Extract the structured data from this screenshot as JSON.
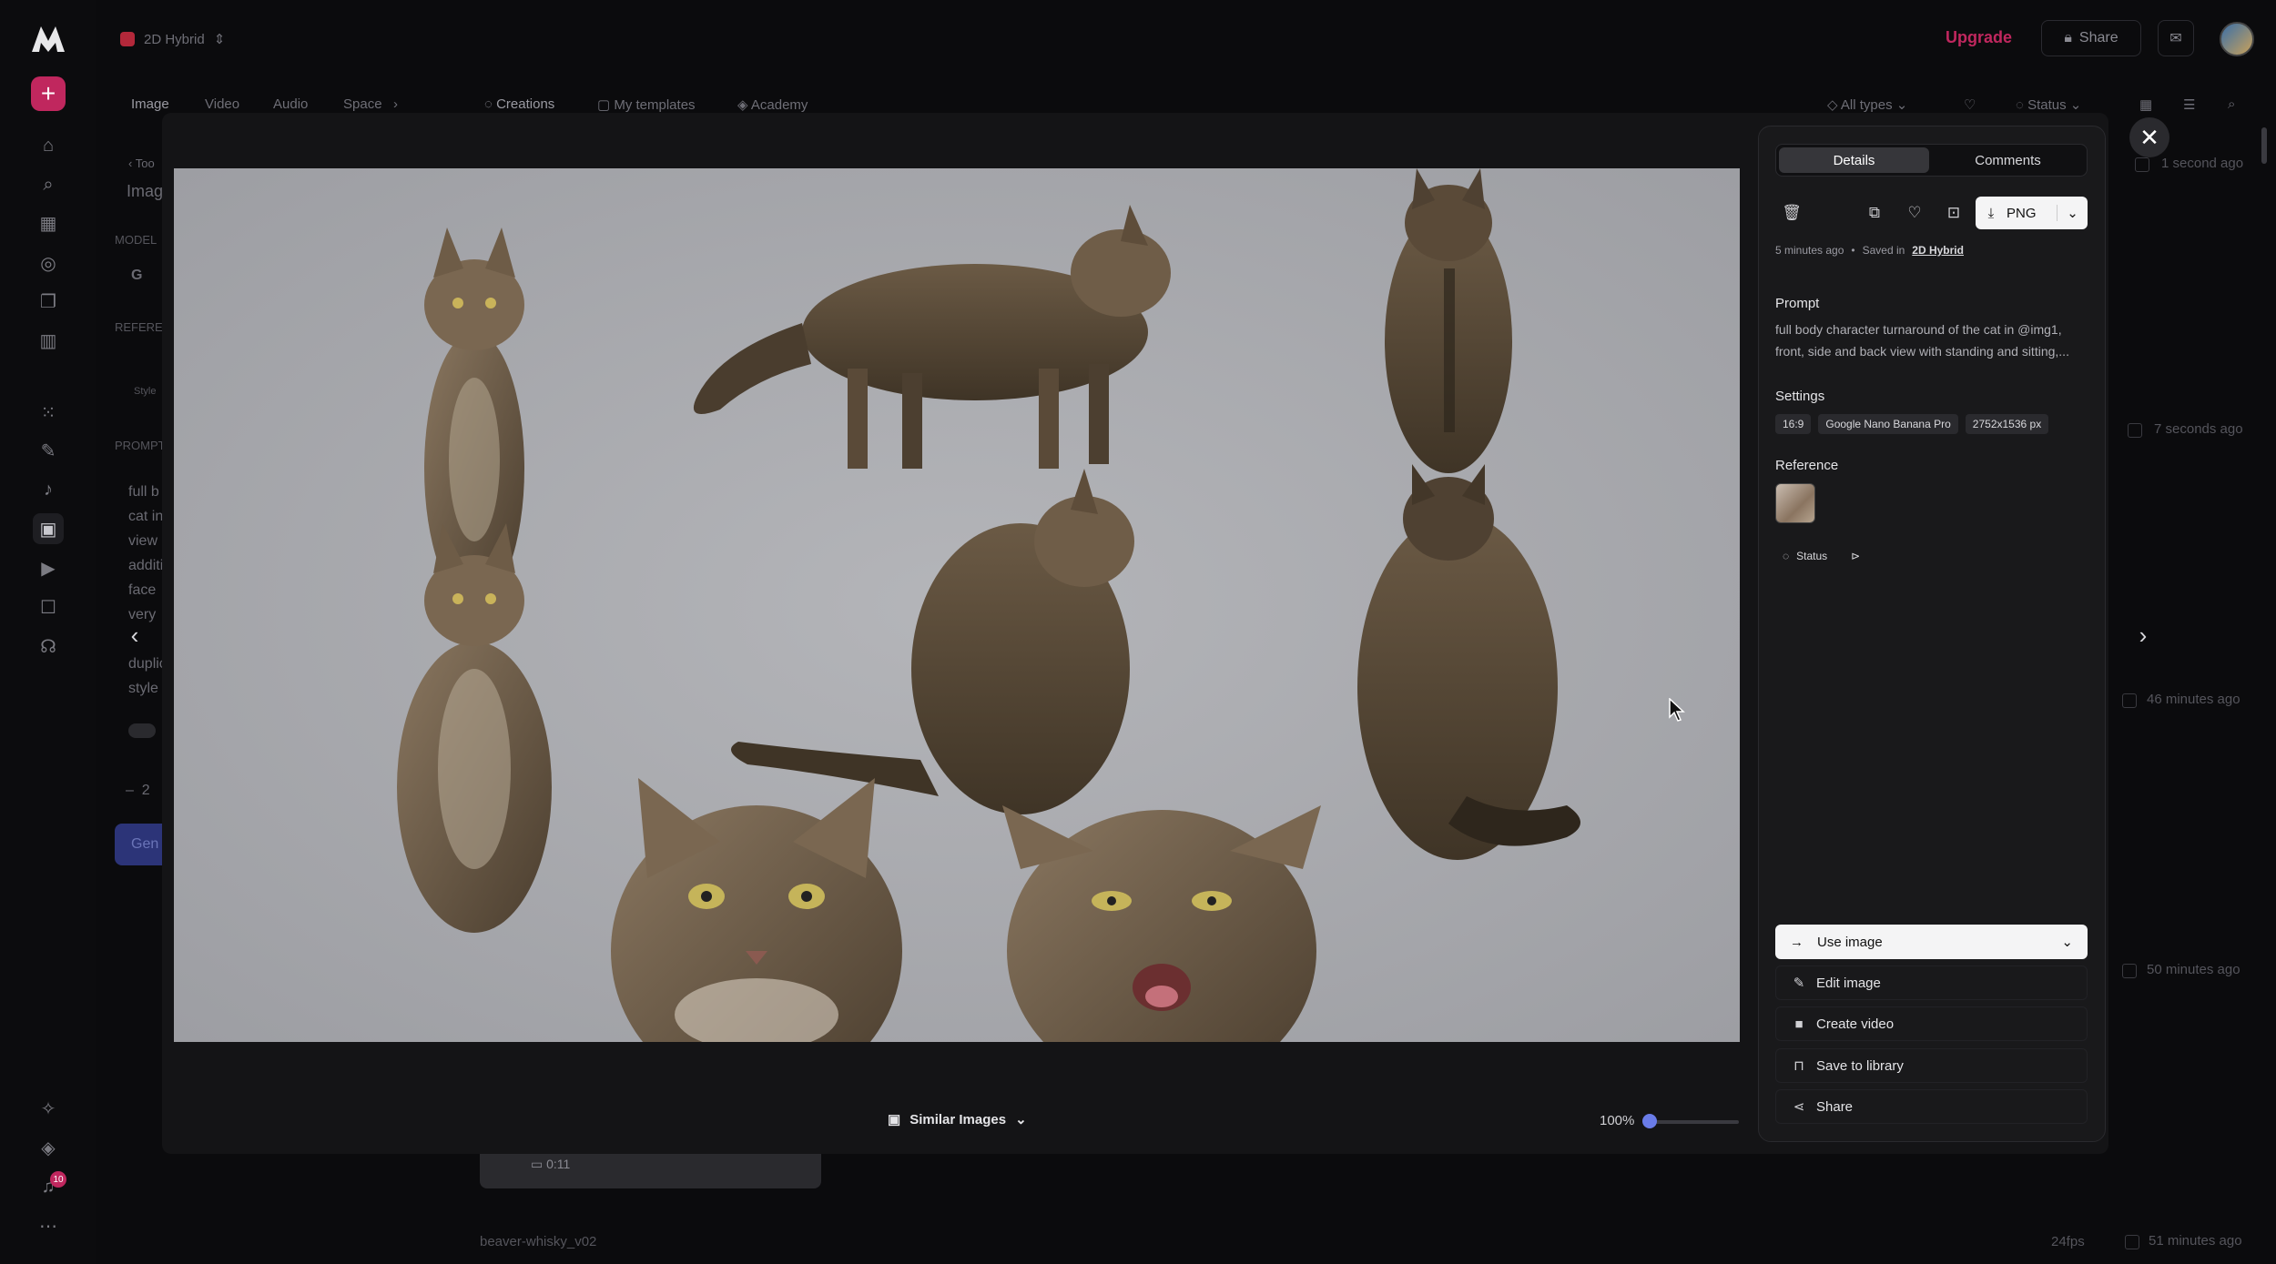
{
  "topbar": {
    "project_name": "2D Hybrid",
    "upgrade_label": "Upgrade",
    "share_label": "Share"
  },
  "nav": {
    "tabs": [
      "Image",
      "Video",
      "Audio",
      "Space"
    ],
    "sections": [
      "Creations",
      "My templates",
      "Academy"
    ],
    "filter_types": "All types",
    "filter_status": "Status"
  },
  "bg_panel": {
    "back_label": "Too",
    "title": "Imag",
    "model_label": "MODEL",
    "model_value": "G",
    "references_label": "REFEREN",
    "style_label": "Style",
    "prompt_label": "PROMPT",
    "prompt_lines": [
      "full b",
      "cat in",
      "view",
      "additi",
      "face",
      "very",
      "duplic",
      "style"
    ],
    "count": "2",
    "generate_label": "Gen"
  },
  "timestamps": [
    "1 second ago",
    "7 seconds ago",
    "46 minutes ago",
    "50 minutes ago",
    "51 minutes ago"
  ],
  "modal": {
    "similar_label": "Similar Images",
    "zoom_label": "100%",
    "zoom_level": 0
  },
  "panel": {
    "tab_details": "Details",
    "tab_comments": "Comments",
    "download_format": "PNG",
    "time_ago": "5 minutes ago",
    "saved_in_label": "Saved in",
    "saved_in_project": "2D Hybrid",
    "prompt_title": "Prompt",
    "prompt_text": "full body character turnaround of the cat in @img1, front, side and back view with standing and sitting,...",
    "settings_title": "Settings",
    "settings_chips": [
      "16:9",
      "Google Nano Banana Pro",
      "2752x1536 px"
    ],
    "reference_title": "Reference",
    "status_label": "Status",
    "use_image_label": "Use image",
    "actions": [
      "Edit image",
      "Create video",
      "Save to library",
      "Share"
    ]
  },
  "bottom": {
    "file_name": "beaver-whisky_v02",
    "fps": "24fps",
    "video_duration": "0:11"
  },
  "notifications_count": "10",
  "colors": {
    "accent": "#c0275e",
    "panel_bg": "#19191b",
    "image_bg": "#a6a7ab",
    "zoom_knob": "#6a7ce8"
  }
}
